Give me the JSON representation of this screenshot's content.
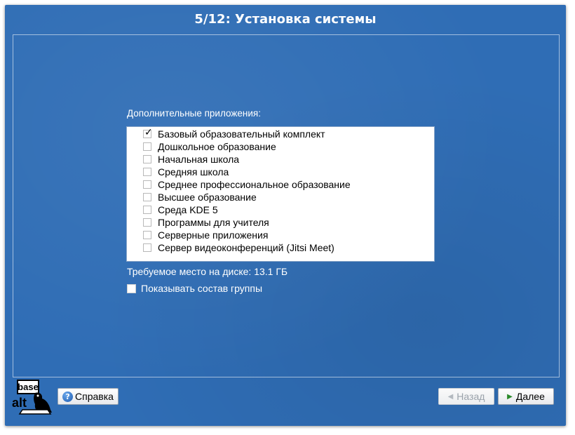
{
  "window": {
    "title": "5/12: Установка системы"
  },
  "main": {
    "section_label": "Дополнительные приложения:",
    "items": [
      {
        "label": "Базовый образовательный комплект",
        "checked": true
      },
      {
        "label": "Дошкольное образование",
        "checked": false
      },
      {
        "label": "Начальная школа",
        "checked": false
      },
      {
        "label": "Средняя школа",
        "checked": false
      },
      {
        "label": "Среднее профессиональное образование",
        "checked": false
      },
      {
        "label": "Высшее образование",
        "checked": false
      },
      {
        "label": "Среда KDE 5",
        "checked": false
      },
      {
        "label": "Программы для учителя",
        "checked": false
      },
      {
        "label": "Серверные приложения",
        "checked": false
      },
      {
        "label": "Сервер видеоконференций (Jitsi Meet)",
        "checked": false
      }
    ],
    "disk_space": "Требуемое место на диске: 13.1 ГБ",
    "show_group": {
      "label": "Показывать состав группы",
      "checked": false
    }
  },
  "logo": {
    "top": "base",
    "bottom": "alt",
    "icon": "seal-logo"
  },
  "footer": {
    "help": {
      "label": "Справка",
      "icon": "help-icon"
    },
    "back": {
      "label": "Назад",
      "icon": "arrow-left-icon",
      "enabled": false
    },
    "next": {
      "label": "Далее",
      "icon": "arrow-right-icon",
      "enabled": true
    }
  },
  "colors": {
    "background": "#2f6db5",
    "accent_next": "#2a8a2a"
  }
}
